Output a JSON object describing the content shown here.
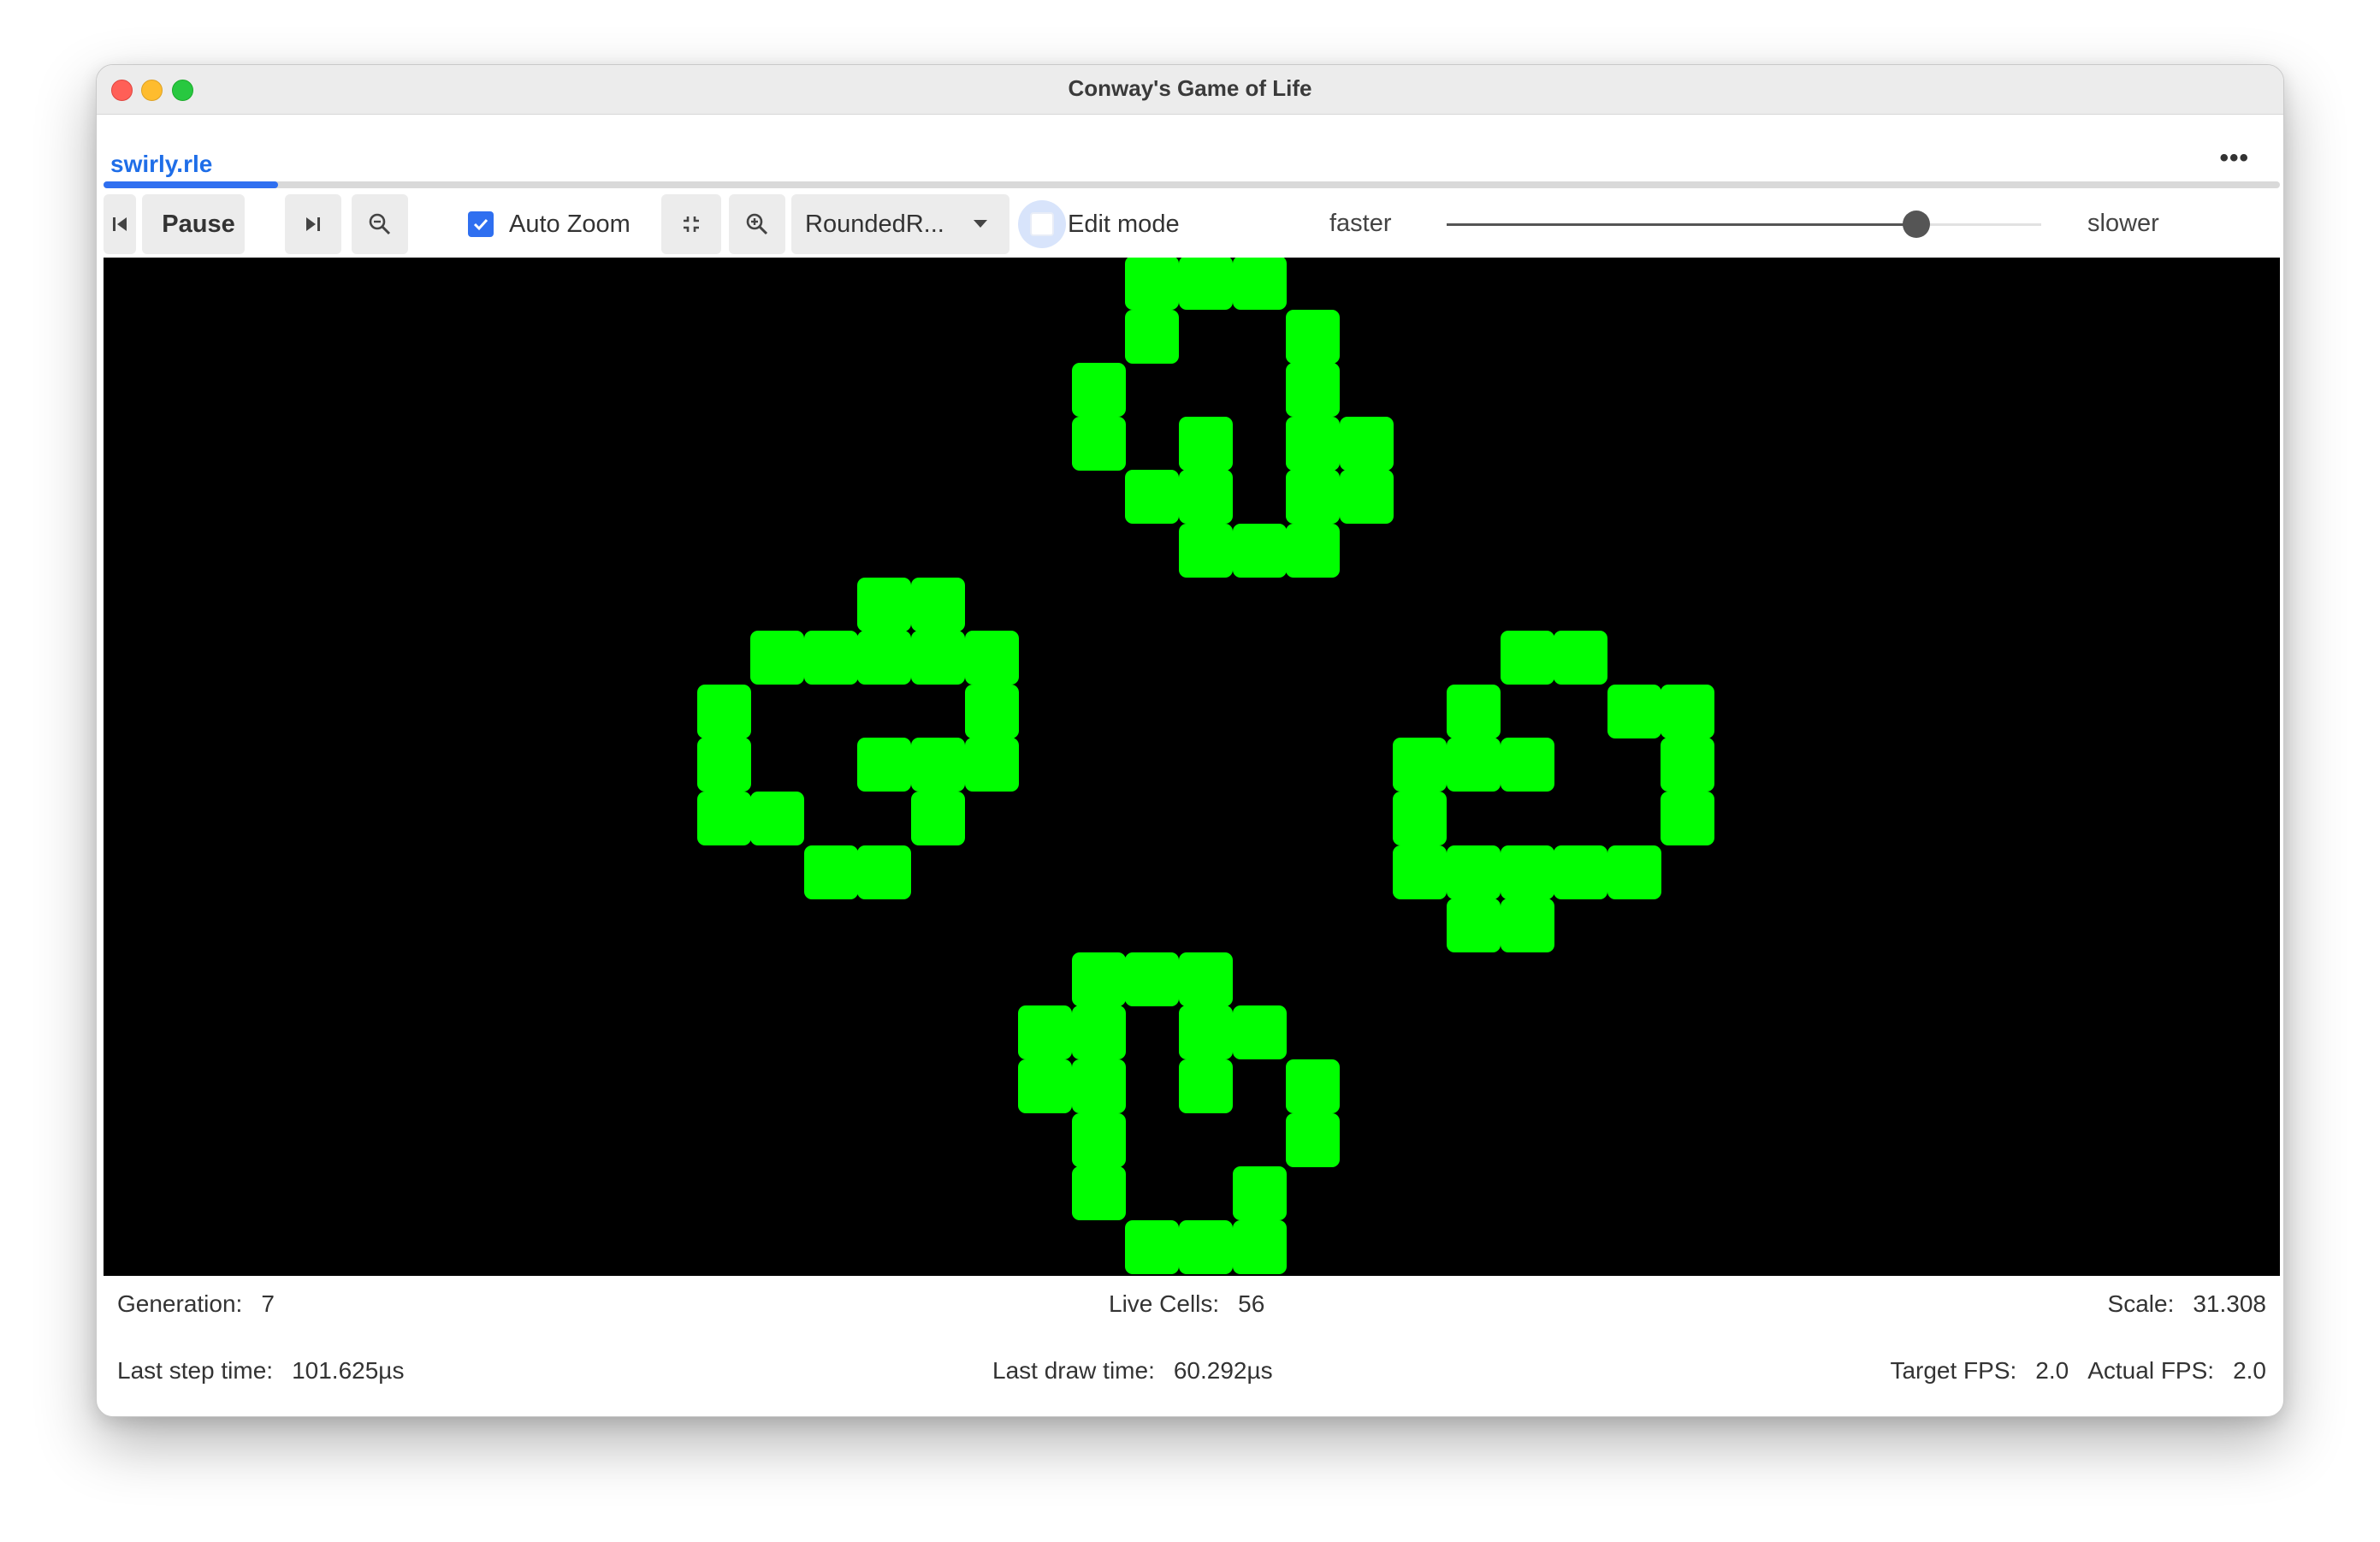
{
  "window": {
    "title": "Conway's Game of Life"
  },
  "tab": {
    "label": "swirly.rle",
    "more_icon": "ellipsis-icon",
    "progress": 0.08
  },
  "toolbar": {
    "pause_label": "Pause",
    "auto_zoom_label": "Auto Zoom",
    "auto_zoom_checked": true,
    "cell_style_selected": "RoundedR...",
    "edit_mode_label": "Edit mode",
    "edit_mode_checked": false,
    "faster_label": "faster",
    "slower_label": "slower",
    "speed_value": 0.79
  },
  "board": {
    "background": "#000000",
    "cell_color": "#00ff00",
    "live_cells": [
      [
        19,
        0
      ],
      [
        20,
        0
      ],
      [
        21,
        0
      ],
      [
        19,
        1
      ],
      [
        22,
        1
      ],
      [
        18,
        2
      ],
      [
        22,
        2
      ],
      [
        18,
        3
      ],
      [
        20,
        3
      ],
      [
        22,
        3
      ],
      [
        23,
        3
      ],
      [
        19,
        4
      ],
      [
        20,
        4
      ],
      [
        22,
        4
      ],
      [
        23,
        4
      ],
      [
        20,
        5
      ],
      [
        21,
        5
      ],
      [
        22,
        5
      ],
      [
        14,
        6
      ],
      [
        15,
        6
      ],
      [
        12,
        7
      ],
      [
        13,
        7
      ],
      [
        14,
        7
      ],
      [
        15,
        7
      ],
      [
        16,
        7
      ],
      [
        26,
        7
      ],
      [
        27,
        7
      ],
      [
        11,
        8
      ],
      [
        16,
        8
      ],
      [
        25,
        8
      ],
      [
        28,
        8
      ],
      [
        29,
        8
      ],
      [
        11,
        9
      ],
      [
        14,
        9
      ],
      [
        15,
        9
      ],
      [
        16,
        9
      ],
      [
        24,
        9
      ],
      [
        25,
        9
      ],
      [
        26,
        9
      ],
      [
        29,
        9
      ],
      [
        11,
        10
      ],
      [
        12,
        10
      ],
      [
        15,
        10
      ],
      [
        24,
        10
      ],
      [
        29,
        10
      ],
      [
        13,
        11
      ],
      [
        14,
        11
      ],
      [
        24,
        11
      ],
      [
        25,
        11
      ],
      [
        26,
        11
      ],
      [
        27,
        11
      ],
      [
        28,
        11
      ],
      [
        25,
        12
      ],
      [
        26,
        12
      ],
      [
        18,
        13
      ],
      [
        19,
        13
      ],
      [
        20,
        13
      ],
      [
        17,
        14
      ],
      [
        18,
        14
      ],
      [
        20,
        14
      ],
      [
        21,
        14
      ],
      [
        17,
        15
      ],
      [
        18,
        15
      ],
      [
        20,
        15
      ],
      [
        22,
        15
      ],
      [
        18,
        16
      ],
      [
        22,
        16
      ],
      [
        18,
        17
      ],
      [
        21,
        17
      ],
      [
        19,
        18
      ],
      [
        20,
        18
      ],
      [
        21,
        18
      ]
    ]
  },
  "status": {
    "generation_label": "Generation:",
    "generation_value": "7",
    "live_cells_label": "Live Cells:",
    "live_cells_value": "56",
    "scale_label": "Scale:",
    "scale_value": "31.308",
    "last_step_label": "Last step time:",
    "last_step_value": "101.625µs",
    "last_draw_label": "Last draw time:",
    "last_draw_value": "60.292µs",
    "target_fps_label": "Target FPS:",
    "target_fps_value": "2.0",
    "actual_fps_label": "Actual FPS:",
    "actual_fps_value": "2.0"
  }
}
